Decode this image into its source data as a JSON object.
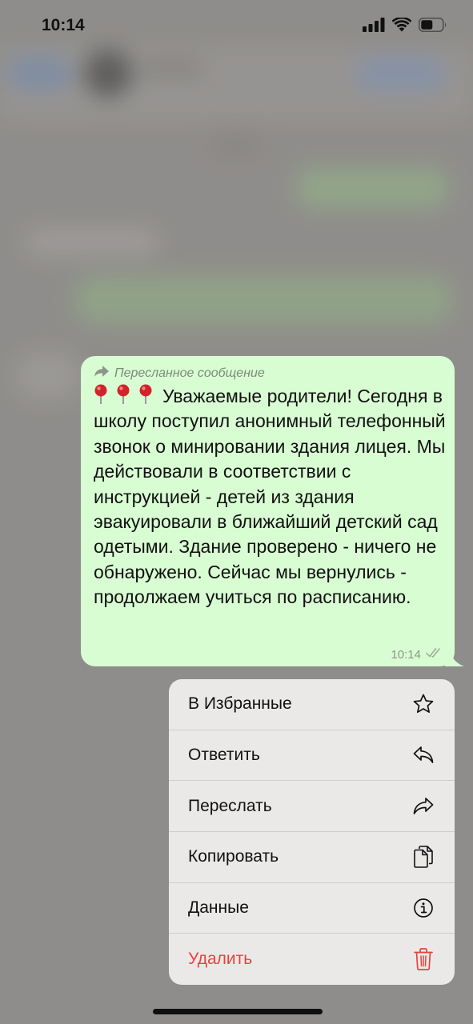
{
  "status_bar": {
    "time": "10:14"
  },
  "message": {
    "forwarded_label": "Пересланное сообщение",
    "text": "Уважаемые родители! Сегодня в школу поступил анонимный телефонный звонок о минировании здания лицея. Мы действовали в соответствии с инструкцией - детей из здания эвакуировали в ближайший детский сад одетыми. Здание проверено - ничего не обнаружено. Сейчас мы вернулись - продолжаем учиться по расписанию.",
    "time": "10:14",
    "status": "read",
    "bubble_color": "#d9fdd3",
    "emoji_icons": [
      "pushpin-icon",
      "pushpin-icon",
      "pushpin-icon"
    ]
  },
  "menu": {
    "items": [
      {
        "label": "В Избранные",
        "icon": "star-icon"
      },
      {
        "label": "Ответить",
        "icon": "reply-icon"
      },
      {
        "label": "Переслать",
        "icon": "forward-icon"
      },
      {
        "label": "Копировать",
        "icon": "copy-icon"
      },
      {
        "label": "Данные",
        "icon": "info-icon"
      },
      {
        "label": "Удалить",
        "icon": "trash-icon",
        "danger_color": "#e8433b"
      }
    ]
  }
}
